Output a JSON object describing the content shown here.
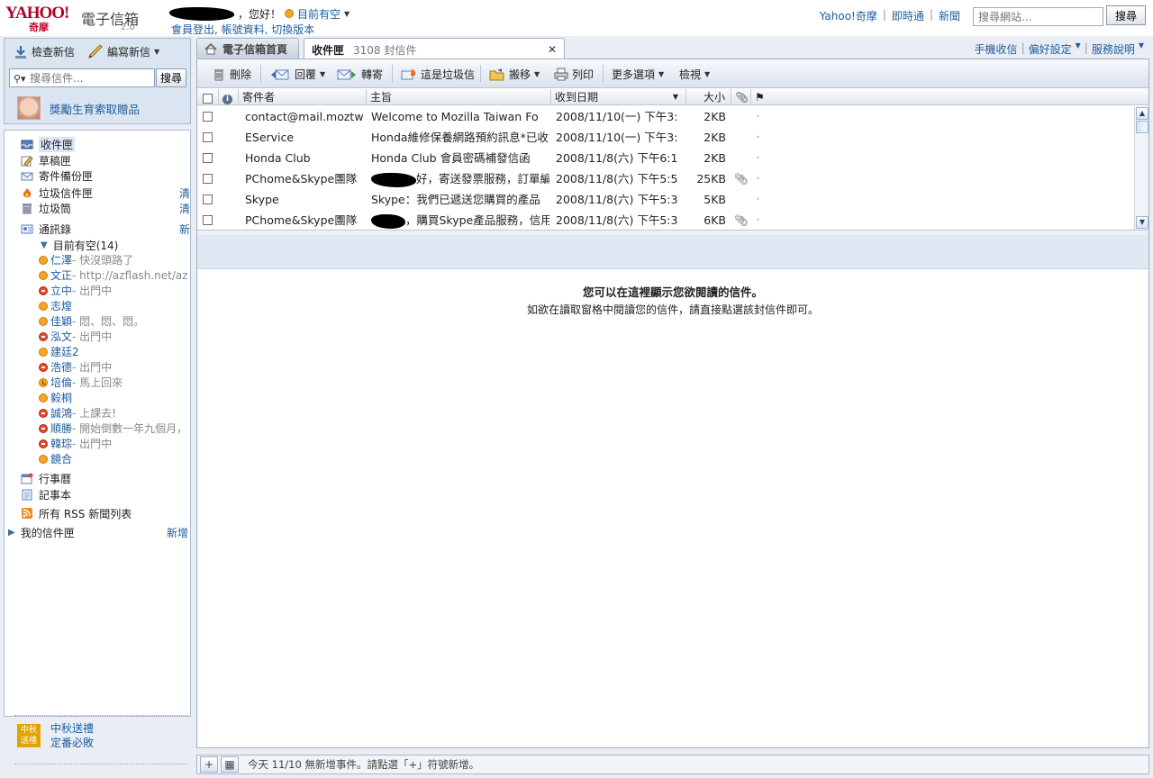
{
  "header": {
    "logo_text": "YAHOO!",
    "logo_sub": "奇摩",
    "product": "電子信箱",
    "version": "2.0",
    "greeting": "，您好！",
    "status": "目前有空",
    "account_links": "會員登出, 帳號資料, 切換版本",
    "top_links": [
      "Yahoo!奇摩",
      "即時通",
      "新聞"
    ],
    "web_search_placeholder": "搜尋網站...",
    "web_search_button": "搜尋"
  },
  "sidebar": {
    "check_mail": "檢查新信",
    "compose": "編寫新信",
    "search_placeholder": "搜尋信件...",
    "search_button": "搜尋",
    "promo": "獎勵生育索取贈品",
    "folders": [
      {
        "label": "收件匣",
        "icon": "inbox-icon",
        "action": ""
      },
      {
        "label": "草稿匣",
        "icon": "drafts-icon",
        "action": ""
      },
      {
        "label": "寄件備份匣",
        "icon": "sent-icon",
        "action": ""
      },
      {
        "label": "垃圾信件匣",
        "icon": "spam-icon",
        "action": "清空"
      },
      {
        "label": "垃圾筒",
        "icon": "trash-icon",
        "action": "清空"
      }
    ],
    "contacts_label": "通訊錄",
    "contacts_action": "新增",
    "online_group": "目前有空(14)",
    "contacts": [
      {
        "name": "仁澤",
        "status": " - 快沒頭路了",
        "state": "available"
      },
      {
        "name": "文正",
        "status": " - http://azflash.net/az",
        "state": "available"
      },
      {
        "name": "立中",
        "status": " - 出門中",
        "state": "busy"
      },
      {
        "name": "志煌",
        "status": "",
        "state": "available"
      },
      {
        "name": "佳穎",
        "status": " - 悶、悶、悶。",
        "state": "available"
      },
      {
        "name": "泓文",
        "status": " - 出門中",
        "state": "busy"
      },
      {
        "name": "建廷2",
        "status": "",
        "state": "available"
      },
      {
        "name": "浩德",
        "status": " - 出門中",
        "state": "busy"
      },
      {
        "name": "培倫",
        "status": " - 馬上回來",
        "state": "away"
      },
      {
        "name": "毅桐",
        "status": "",
        "state": "available"
      },
      {
        "name": "誠鴻",
        "status": " - 上課去!",
        "state": "busy"
      },
      {
        "name": "順勝",
        "status": " - 開始倒數一年九個月，",
        "state": "busy"
      },
      {
        "name": "韓琮",
        "status": " - 出門中",
        "state": "busy"
      },
      {
        "name": "鏡合",
        "status": "",
        "state": "available"
      }
    ],
    "calendar": "行事曆",
    "notepad": "記事本",
    "rss": "所有 RSS 新聞列表",
    "my_folders": "我的信件匣",
    "my_folders_action": "新增",
    "ad_badge": "中秋送禮",
    "ad_line1": "中秋送禮",
    "ad_line2": "定番必敗"
  },
  "tabs": {
    "home": "電子信箱首頁",
    "inbox": "收件匣",
    "inbox_count": "3108 封信件",
    "right_links": [
      "手機收信",
      "偏好設定",
      "服務說明"
    ]
  },
  "toolbar": {
    "delete": "刪除",
    "reply": "回覆",
    "forward": "轉寄",
    "spam": "這是垃圾信",
    "move": "搬移",
    "print": "列印",
    "more": "更多選項",
    "view": "檢視"
  },
  "columns": {
    "sender": "寄件者",
    "subject": "主旨",
    "date": "收到日期",
    "size": "大小"
  },
  "messages": [
    {
      "sender": "contact@mail.moztw",
      "subject": "Welcome to Mozilla Taiwan Fo",
      "date": "2008/11/10(一) 下午3:",
      "size": "2KB",
      "attach": false
    },
    {
      "sender": "EService",
      "subject": "Honda維修保養網路預約訊息*已收",
      "date": "2008/11/10(一) 下午3:",
      "size": "2KB",
      "attach": false
    },
    {
      "sender": "Honda Club",
      "subject": "Honda Club 會員密碼補發信函",
      "date": "2008/11/8(六) 下午6:1",
      "size": "2KB",
      "attach": false
    },
    {
      "sender": "PChome&Skype團隊",
      "subject": "好，寄送發票服務，訂單編",
      "date": "2008/11/8(六) 下午5:5",
      "size": "25KB",
      "attach": true
    },
    {
      "sender": "Skype",
      "subject": "Skype：我們已遞送您購買的產品",
      "date": "2008/11/8(六) 下午5:3",
      "size": "5KB",
      "attach": false
    },
    {
      "sender": "PChome&Skype團隊",
      "subject": "，購買Skype產品服務，信用",
      "date": "2008/11/8(六) 下午5:3",
      "size": "6KB",
      "attach": true
    }
  ],
  "preview": {
    "heading": "您可以在這裡顯示您欲閱讀的信件。",
    "sub": "如欲在讀取窗格中閱讀您的信件，請直接點選該封信件即可。"
  },
  "bottom": {
    "text": "今天 11/10  無新增事件。請點選「+」符號新增。"
  }
}
